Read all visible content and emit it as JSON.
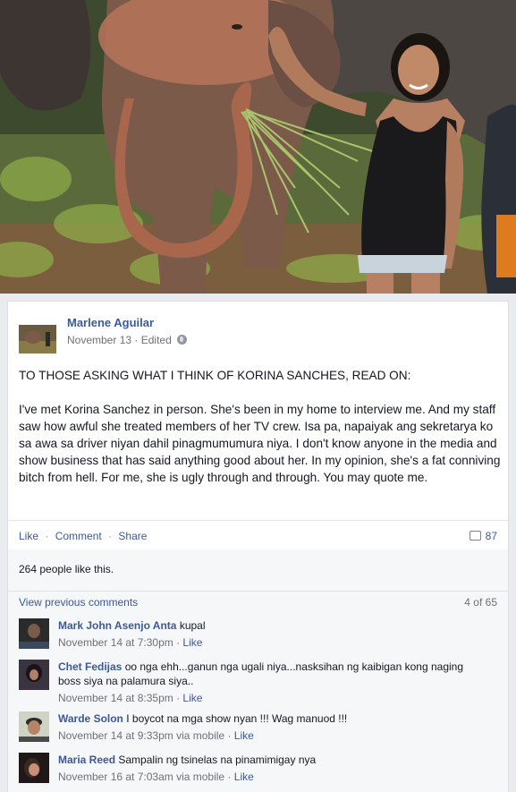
{
  "post": {
    "author": "Marlene Aguilar",
    "date": "November 13",
    "edited": "· Edited",
    "paragraph1": "TO THOSE ASKING WHAT I THINK OF KORINA SANCHES, READ ON:",
    "paragraph2": "I've met Korina Sanchez in person. She's been in my home to interview me. And my staff saw how awful she treated members of her TV crew. Isa pa, napaiyak ang sekretarya ko sa awa sa driver niyan dahil pinagmumumura niya. I don't know anyone in the media and show business that has said anything good about her. In my opinion, she's a fat conniving bitch from hell. For me, she is ugly through and through. You may quote me."
  },
  "actions": {
    "like": "Like",
    "comment": "Comment",
    "share": "Share",
    "separator": "·",
    "comment_count": "87"
  },
  "ufi": {
    "likes_text": "264 people like this.",
    "view_previous": "View previous comments",
    "page_count": "4 of 65"
  },
  "comments": [
    {
      "name": "Mark John Asenjo Anta",
      "text": "kupal",
      "time": "November 14 at 7:30pm",
      "via": "",
      "like": "Like"
    },
    {
      "name": "Chet Fedijas",
      "text": "oo nga ehh...ganun nga ugali niya...nasksihan ng kaibigan kong naging boss siya na palamura siya..",
      "time": "November 14 at 8:35pm",
      "via": "",
      "like": "Like"
    },
    {
      "name": "Warde Solon",
      "text": "I boycot na mga show nyan !!! Wag manuod !!!",
      "time": "November 14 at 9:33pm",
      "via": " via mobile",
      "like": "Like"
    },
    {
      "name": "Maria Reed",
      "text": "Sampalin ng tsinelas na pinamimigay nya",
      "time": "November 16 at 7:03am",
      "via": " via mobile",
      "like": "Like"
    }
  ],
  "colors": {
    "link": "#3b5998",
    "meta": "#6d7078",
    "background": "#e9ebee"
  }
}
